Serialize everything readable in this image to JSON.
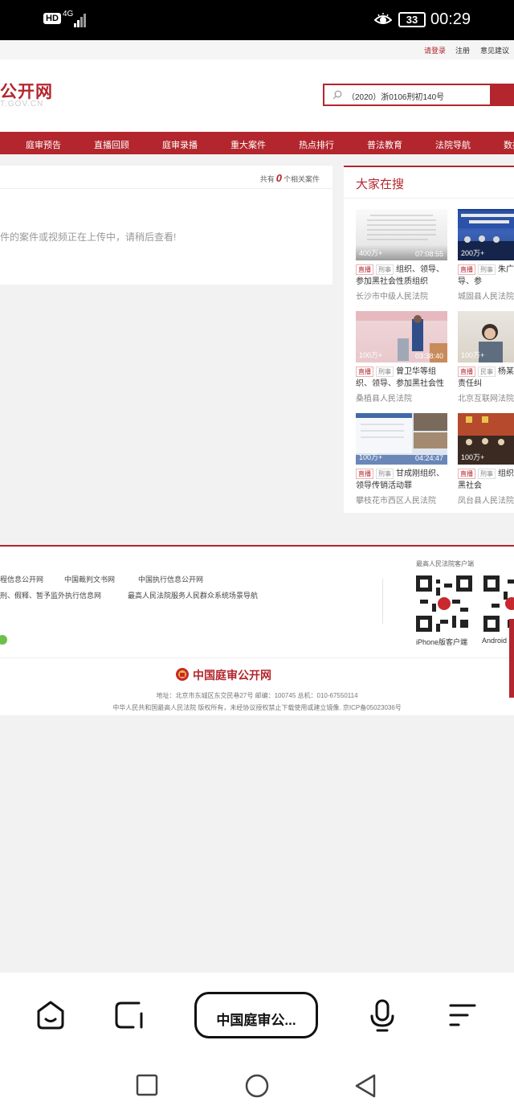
{
  "status": {
    "hd": "HD",
    "network": "4G",
    "battery": "33",
    "time": "00:29"
  },
  "toplinks": {
    "login": "请登录",
    "register": "注册",
    "feedback": "意见建议"
  },
  "header": {
    "logo_text": "公开网",
    "logo_sub": "T.GOV.CN"
  },
  "search": {
    "value": "（2020）浙0106刑初140号"
  },
  "nav": [
    "庭审预告",
    "直播回顾",
    "庭审录播",
    "重大案件",
    "热点排行",
    "普法教育",
    "法院导航",
    "数据"
  ],
  "result": {
    "count_prefix": "共有",
    "count": "0",
    "count_suffix": "个相关案件",
    "empty_msg": "件的案件或视频正在上传中，请稍后查看!"
  },
  "side": {
    "title": "大家在搜",
    "cards": [
      {
        "views": "400万+",
        "duration": "07:08:55",
        "tag1": "直播",
        "tag2": "刑事",
        "title": "组织、领导、参加黑社会性质组织",
        "court": "长沙市中级人民法院"
      },
      {
        "views": "200万+",
        "duration": "",
        "tag1": "直播",
        "tag2": "刑事",
        "title": "朱广组织、领导、参",
        "court": "城固县人民法院"
      },
      {
        "views": "100万+",
        "duration": "03:38:40",
        "tag1": "直播",
        "tag2": "刑事",
        "title": "曾卫华等组织、领导、参加黑社会性",
        "court": "桑植县人民法院"
      },
      {
        "views": "100万+",
        "duration": "",
        "tag1": "直播",
        "tag2": "民事",
        "title": "杨某网络侵权责任纠",
        "court": "北京互联网法院"
      },
      {
        "views": "100万+",
        "duration": "04:24:47",
        "tag1": "直播",
        "tag2": "刑事",
        "title": "甘成刚组织、领导传销活动罪",
        "court": "攀枝花市西区人民法院"
      },
      {
        "views": "100万+",
        "duration": "",
        "tag1": "直播",
        "tag2": "刑事",
        "title": "组织导、参加黑社会",
        "court": "凤台县人民法院"
      }
    ]
  },
  "footer": {
    "links_row1": [
      "程信息公开网",
      "中国裁判文书网",
      "中国执行信息公开网"
    ],
    "links_row2": [
      "刑、假释、暂予监外执行信息网",
      "最高人民法院服务人民群众系统场景导航"
    ],
    "qr_title": "最高人民法院客户端",
    "qr_iphone": "iPhone版客户端",
    "qr_android": "Android",
    "brand": "中国庭审公开网",
    "address": "地址：北京市东城区东交民巷27号    邮编：100745    总机：010-67550114",
    "copyright": "中华人民共和国最高人民法院 版权所有，未经协议授权禁止下载使用或建立镜像. 京ICP备05023036号"
  },
  "browser": {
    "url_label": "中国庭审公..."
  },
  "colors": {
    "accent": "#b3262d"
  }
}
